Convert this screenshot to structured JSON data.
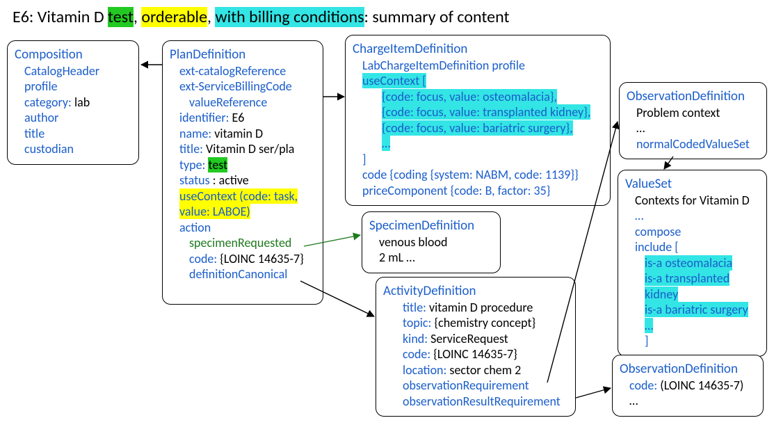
{
  "title": {
    "prefix": "E6: Vitamin D ",
    "hl_test": "test",
    "sep1": ", ",
    "hl_orderable": "orderable",
    "sep2": ", ",
    "hl_billing": "with billing conditions",
    "suffix": ": summary of content"
  },
  "composition": {
    "header": "Composition",
    "l1": "CatalogHeader profile",
    "l2a": "category:",
    "l2b": " lab",
    "l3": "author",
    "l4": "title",
    "l5": "custodian"
  },
  "plan": {
    "header": "PlanDefinition",
    "l1": "ext-catalogReference",
    "l2": "ext-ServiceBillingCode",
    "l3": "valueReference",
    "l4a": "identifier:",
    "l4b": " E6",
    "l5a": "name:",
    "l5b": " vitamin D",
    "l6a": "title:",
    "l6b": " Vitamin D ser/pla",
    "l7a": "type: ",
    "l7b": "test",
    "l8a": "status",
    "l8b": " : active",
    "l9a": "useContext (code: task,",
    "l9b": "value: LABOE)",
    "l10": "action",
    "l11": "specimenRequested",
    "l12a": "code:",
    "l12b": " {LOINC 14635-7}",
    "l13": "definitionCanonical"
  },
  "charge": {
    "header": "ChargeItemDefinition",
    "l1": "LabChargeItemDefinition profile",
    "l2": "useContext [",
    "l3": "{code: focus, value: osteomalacia},",
    "l4": "{code: focus, value: transplanted kidney},",
    "l5": "{code: focus, value: bariatric surgery},",
    "l6": "…",
    "l7": "]",
    "l8a": "code {coding {system: NABM, code: 1139",
    "l8b": "}}",
    "l9a": "priceComponent {code: B, factor: 35",
    "l9b": "}"
  },
  "specimen": {
    "header": "SpecimenDefinition",
    "l1": "venous blood",
    "l2": "2 mL …"
  },
  "activity": {
    "header": "ActivityDefinition",
    "l1a": "title:",
    "l1b": " vitamin D procedure",
    "l2a": "topic:",
    "l2b": " {chemistry concept}",
    "l3a": "kind:",
    "l3b": " ServiceRequest",
    "l4a": "code:",
    "l4b": " {LOINC 14635-7}",
    "l5a": "location:",
    "l5b": " sector chem 2",
    "l6": "observationRequirement",
    "l7": "observationResultRequirement"
  },
  "obs1": {
    "header": "ObservationDefinition",
    "l1": "Problem context",
    "l2": "…",
    "l3": "normalCodedValueSet"
  },
  "valueset": {
    "header": "ValueSet",
    "l1": "Contexts for Vitamin D",
    "l2": "…",
    "l3": "compose",
    "l4": "include [",
    "l5": "is-a osteomalacia",
    "l6": "is-a transplanted kidney",
    "l7": "is-a bariatric surgery",
    "l8": "…",
    "l9": "]"
  },
  "obs2": {
    "header": "ObservationDefinition",
    "l1a": "code:",
    "l1b": " (LOINC 14635-7)",
    "l2": "…"
  }
}
